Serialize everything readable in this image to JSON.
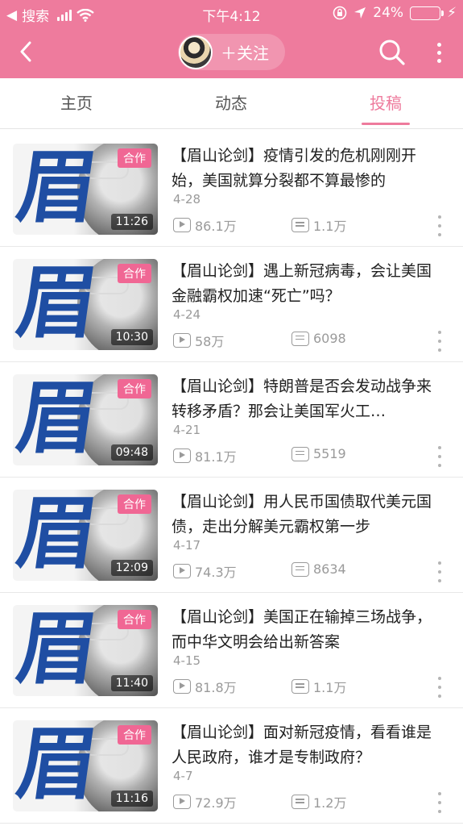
{
  "status_bar": {
    "back_app": "搜索",
    "time": "下午4:12",
    "battery": "24%",
    "battery_level": 0.24
  },
  "header": {
    "follow_label": "＋关注"
  },
  "tabs": [
    {
      "label": "主页",
      "active": false
    },
    {
      "label": "动态",
      "active": false
    },
    {
      "label": "投稿",
      "active": true
    }
  ],
  "videos": [
    {
      "badge": "合作",
      "duration": "11:26",
      "title": "【眉山论剑】疫情引发的危机刚刚开始，美国就算分裂都不算最惨的",
      "date": "4-28",
      "plays": "86.1万",
      "danmaku": "1.1万"
    },
    {
      "badge": "合作",
      "duration": "10:30",
      "title": "【眉山论剑】遇上新冠病毒，会让美国金融霸权加速“死亡”吗？",
      "date": "4-24",
      "plays": "58万",
      "danmaku": "6098"
    },
    {
      "badge": "合作",
      "duration": "09:48",
      "title": "【眉山论剑】特朗普是否会发动战争来转移矛盾？那会让美国军火工…",
      "date": "4-21",
      "plays": "81.1万",
      "danmaku": "5519"
    },
    {
      "badge": "合作",
      "duration": "12:09",
      "title": "【眉山论剑】用人民币国债取代美元国债，走出分解美元霸权第一步",
      "date": "4-17",
      "plays": "74.3万",
      "danmaku": "8634"
    },
    {
      "badge": "合作",
      "duration": "11:40",
      "title": "【眉山论剑】美国正在输掉三场战争，而中华文明会给出新答案",
      "date": "4-15",
      "plays": "81.8万",
      "danmaku": "1.1万"
    },
    {
      "badge": "合作",
      "duration": "11:16",
      "title": "【眉山论剑】面对新冠疫情，看看谁是人民政府，谁才是专制政府？",
      "date": "4-7",
      "plays": "72.9万",
      "danmaku": "1.2万"
    }
  ],
  "thumbnail_glyph": "眉",
  "colors": {
    "brand": "#ee7b9d",
    "badge": "#f06794",
    "battery_fill": "#5ee06c"
  }
}
